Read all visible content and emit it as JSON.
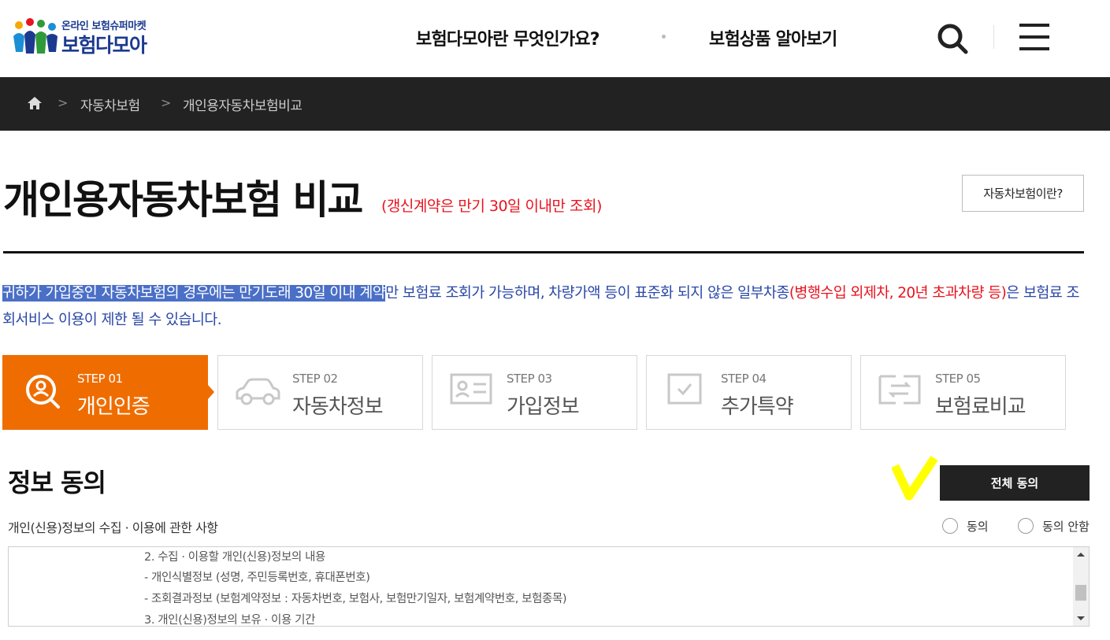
{
  "header": {
    "logo_sub": "온라인 보험슈퍼마켓",
    "logo_main": "보험다모아",
    "nav": [
      "보험다모아란 무엇인가요?",
      "보험상품 알아보기"
    ]
  },
  "breadcrumb": {
    "items": [
      "자동차보험",
      "개인용자동차보험비교"
    ]
  },
  "title": {
    "main": "개인용자동차보험 비교",
    "note": "(갱신계약은 만기 30일 이내만 조회)",
    "about_button": "자동차보험이란?"
  },
  "notice": {
    "highlighted": "귀하가 가입중인 자동차보험의 경우에는 만기도래 30일 이내 계약",
    "part1": "만 보험료 조회가 가능하며, 차량가액 등이 표준화 되지 않은 일부차종",
    "red": "(병행수입 외제차, 20년 초과차량 등)",
    "part2": "은 보험료 조회서비스 이용이 제한 될 수 있습니다."
  },
  "steps": [
    {
      "num": "STEP 01",
      "name": "개인인증",
      "icon": "search-user-icon",
      "active": true
    },
    {
      "num": "STEP 02",
      "name": "자동차정보",
      "icon": "car-icon",
      "active": false
    },
    {
      "num": "STEP 03",
      "name": "가입정보",
      "icon": "id-card-icon",
      "active": false
    },
    {
      "num": "STEP 04",
      "name": "추가특약",
      "icon": "checkbox-icon",
      "active": false
    },
    {
      "num": "STEP 05",
      "name": "보험료비교",
      "icon": "compare-icon",
      "active": false
    }
  ],
  "consent": {
    "section_title": "정보 동의",
    "agree_all": "전체 동의",
    "label": "개인(신용)정보의 수집 · 이용에 관한 사항",
    "agree": "동의",
    "disagree": "동의 안함",
    "terms_lines": [
      "2. 수집 · 이용할 개인(신용)정보의 내용",
      "- 개인식별정보 (성명, 주민등록번호, 휴대폰번호)",
      "- 조회결과정보 (보험계약정보 : 자동차번호, 보험사, 보험만기일자, 보험계약번호, 보험종목)",
      "3. 개인(신용)정보의 보유 · 이용 기간"
    ]
  },
  "colors": {
    "accent_orange": "#ef6d00",
    "dark_bar": "#222222",
    "notice_blue": "#2a48a8",
    "alert_red": "#e8141f",
    "highlight_mark": "#ffff00"
  }
}
